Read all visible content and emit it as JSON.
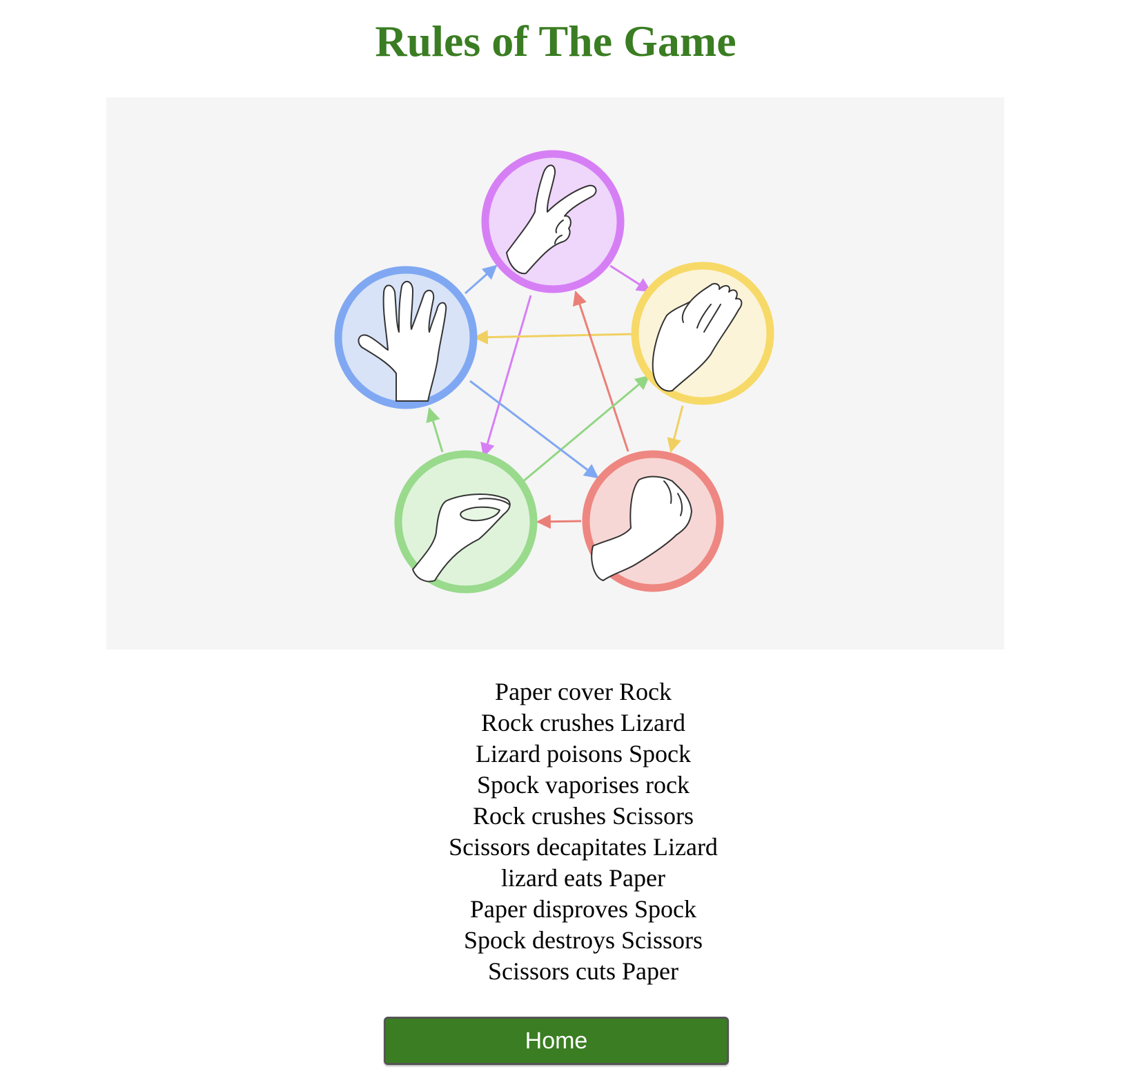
{
  "header": {
    "title": "Rules of The Game"
  },
  "diagram": {
    "nodes": [
      {
        "id": "scissors",
        "gesture": "scissors-hand-icon",
        "ring": "#d67ff5",
        "fill": "#efd6fb"
      },
      {
        "id": "paper",
        "gesture": "paper-hand-icon",
        "ring": "#f7d968",
        "fill": "#fcf4d8"
      },
      {
        "id": "rock",
        "gesture": "rock-fist-icon",
        "ring": "#ee8781",
        "fill": "#f7d7d5"
      },
      {
        "id": "lizard",
        "gesture": "lizard-hand-icon",
        "ring": "#99da8c",
        "fill": "#dff3da"
      },
      {
        "id": "spock",
        "gesture": "spock-hand-icon",
        "ring": "#80a8f2",
        "fill": "#d8e3f8"
      }
    ],
    "background": "#f5f5f5"
  },
  "rules": [
    "Paper cover Rock",
    "Rock crushes Lizard",
    "Lizard poisons Spock",
    "Spock vaporises rock",
    "Rock crushes Scissors",
    "Scissors decapitates Lizard",
    "lizard eats Paper",
    "Paper disproves Spock",
    "Spock destroys Scissors",
    "Scissors cuts Paper"
  ],
  "home_button": {
    "label": "Home"
  },
  "colors": {
    "title": "#3a7d22",
    "button_bg": "#3a7d22",
    "button_text": "#ffffff"
  }
}
